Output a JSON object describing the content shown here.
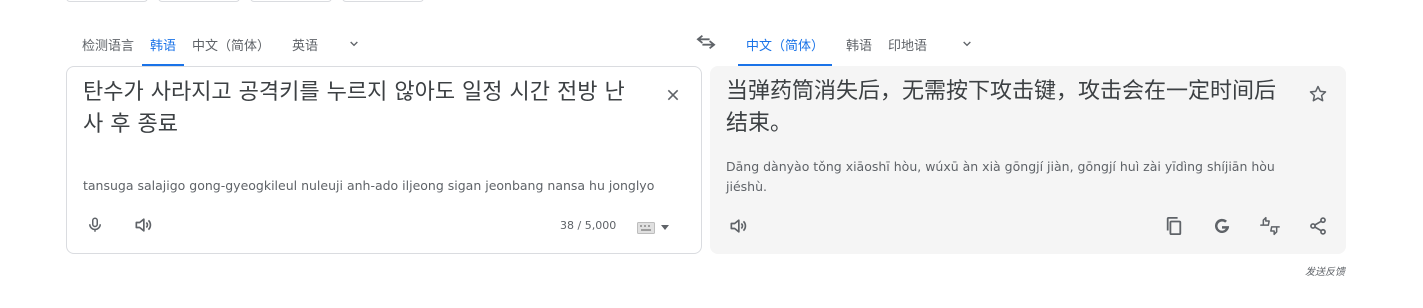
{
  "source_langs": {
    "tabs": [
      {
        "label": "检测语言",
        "active": false
      },
      {
        "label": "韩语",
        "active": true
      },
      {
        "label": "中文（简体）",
        "active": false
      },
      {
        "label": "英语",
        "active": false
      }
    ],
    "more_icon": "chevron-down-icon"
  },
  "target_langs": {
    "tabs": [
      {
        "label": "中文（简体）",
        "active": true
      },
      {
        "label": "韩语",
        "active": false
      },
      {
        "label": "印地语",
        "active": false
      }
    ],
    "more_icon": "chevron-down-icon"
  },
  "source": {
    "text": "탄수가 사라지고 공격키를 누르지 않아도 일정 시간 전방 난사 후 종료",
    "romanization": "tansuga salajigo gong-gyeogkileul nuleuji anh-ado iljeong sigan jeonbang nansa hu jonglyo",
    "char_count": "38 / 5,000"
  },
  "target": {
    "text": "当弹药筒消失后，无需按下攻击键，攻击会在一定时间后结束。",
    "romanization": "Dāng dànyào tǒng xiāoshī hòu, wúxū àn xià gōngjí jiàn, gōngjí huì zài yīdìng shíjiān hòu jiéshù."
  },
  "footer": {
    "feedback": "发送反馈"
  },
  "colors": {
    "accent": "#1a73e8",
    "icon": "#5f6368",
    "target_bg": "#f5f5f5",
    "border": "#dadce0"
  }
}
